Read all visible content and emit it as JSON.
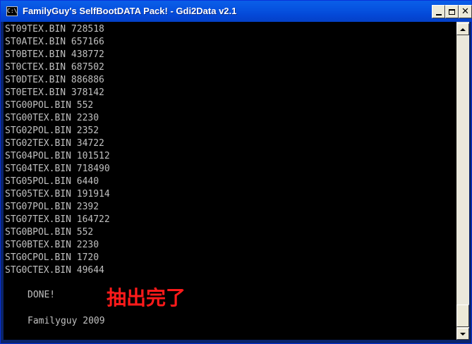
{
  "window": {
    "title": "FamilyGuy's SelfBootDATA Pack! - Gdi2Data v2.1",
    "icon_label": "C:\\",
    "close_glyph": "✕"
  },
  "console": {
    "lines": [
      "ST09TEX.BIN 728518",
      "ST0ATEX.BIN 657166",
      "ST0BTEX.BIN 438772",
      "ST0CTEX.BIN 687502",
      "ST0DTEX.BIN 886886",
      "ST0ETEX.BIN 378142",
      "STG00POL.BIN 552",
      "STG00TEX.BIN 2230",
      "STG02POL.BIN 2352",
      "STG02TEX.BIN 34722",
      "STG04POL.BIN 101512",
      "STG04TEX.BIN 718490",
      "STG05POL.BIN 6440",
      "STG05TEX.BIN 191914",
      "STG07POL.BIN 2392",
      "STG07TEX.BIN 164722",
      "STG0BPOL.BIN 552",
      "STG0BTEX.BIN 2230",
      "STG0CPOL.BIN 1720",
      "STG0CTEX.BIN 49644"
    ],
    "done": "DONE!",
    "extract_done": "抽出完了",
    "credit": "Familyguy 2009"
  },
  "colors": {
    "console_bg": "#000000",
    "console_text": "#c0c0c0",
    "highlight": "#ff1a1a",
    "titlebar": "#0653E0"
  }
}
